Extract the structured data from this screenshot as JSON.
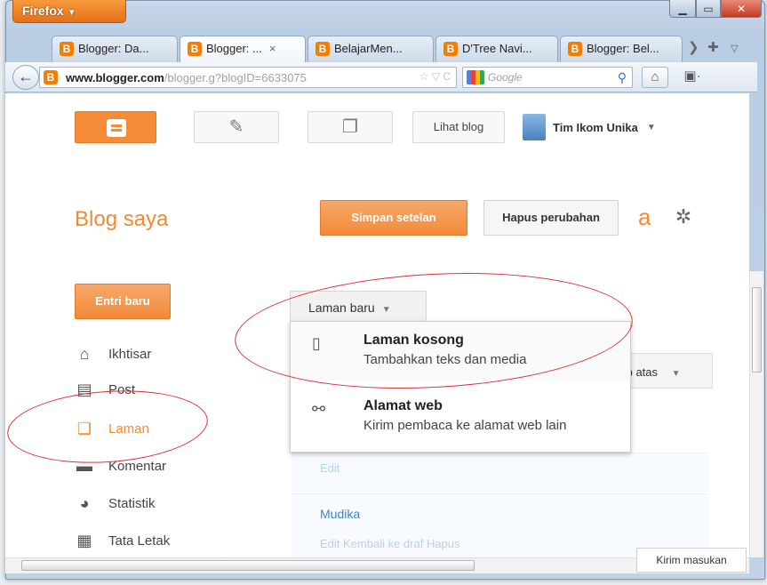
{
  "browser": {
    "menu_button": "Firefox",
    "tabs": [
      {
        "label": "Blogger: Da...",
        "active": false
      },
      {
        "label": "Blogger: ...",
        "active": true
      },
      {
        "label": "BelajarMen...",
        "active": false
      },
      {
        "label": "D'Tree Navi...",
        "active": false
      },
      {
        "label": "Blogger: Bel...",
        "active": false
      }
    ],
    "url_host": "www.blogger.com",
    "url_path": "/blogger.g?blogID=6633075",
    "search_placeholder": "Google"
  },
  "header": {
    "view_blog": "Lihat blog",
    "user_name": "Tim Ikom Unika"
  },
  "page": {
    "blog_title": "Blog saya",
    "save_settings": "Simpan setelan",
    "discard_changes": "Hapus perubahan",
    "behind_letter": "a",
    "new_post": "Entri baru"
  },
  "sidebar": {
    "items": [
      {
        "label": "Ikhtisar",
        "icon": "home-icon",
        "active": false
      },
      {
        "label": "Post",
        "icon": "posts-icon",
        "active": false
      },
      {
        "label": "Laman",
        "icon": "page-icon",
        "active": true
      },
      {
        "label": "Komentar",
        "icon": "comment-icon",
        "active": false
      },
      {
        "label": "Statistik",
        "icon": "stats-icon",
        "active": false
      },
      {
        "label": "Tata Letak",
        "icon": "layout-icon",
        "active": false
      }
    ]
  },
  "pages_menu": {
    "button_label": "Laman baru",
    "options": [
      {
        "title": "Laman kosong",
        "description": "Tambahkan teks dan media",
        "icon": "blank-page-icon"
      },
      {
        "title": "Alamat web",
        "description": "Kirim pembaca ke alamat web lain",
        "icon": "link-icon"
      }
    ]
  },
  "pages_list": {
    "behind_dropdown_text": "ıb atas",
    "row1_edit": "Edit",
    "row2_title": "Mudika",
    "row2_actions": "Edit  Kembali ke draf  Hapus"
  },
  "footer": {
    "send_feedback": "Kirim masukan"
  },
  "colors": {
    "blogger_orange": "#f58a37",
    "annotation_red": "#d9313a",
    "link_blue": "#3b84d6"
  }
}
